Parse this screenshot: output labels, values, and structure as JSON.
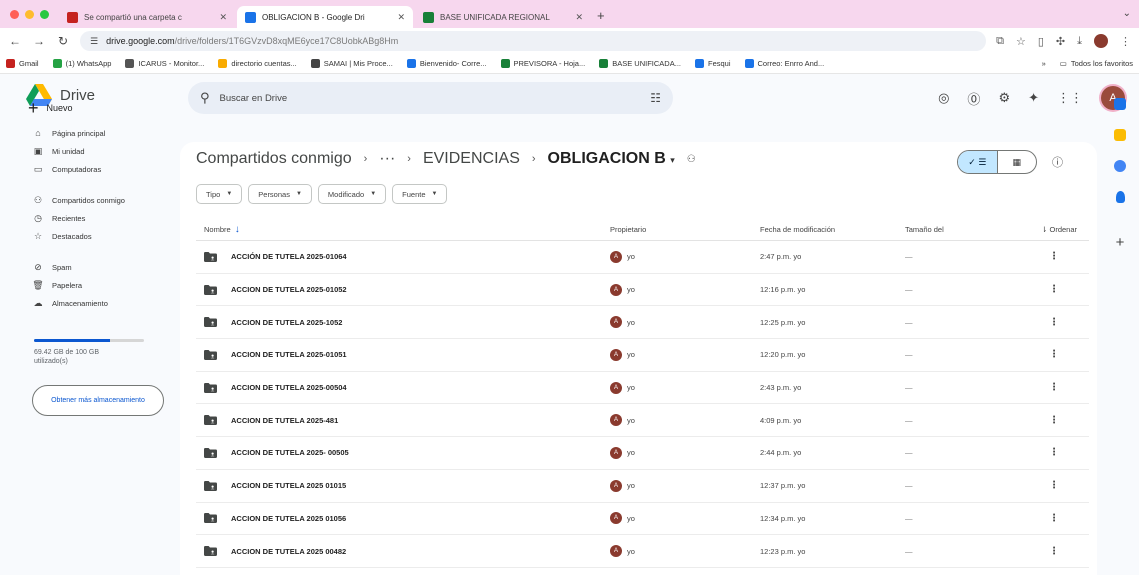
{
  "browser": {
    "tabs": [
      {
        "title": "Se compartió una carpeta c",
        "fav_color": "#c5221f",
        "active": false
      },
      {
        "title": "OBLIGACION B - Google Dri",
        "fav_color": "#1a73e8",
        "active": true
      },
      {
        "title": "BASE UNIFICADA REGIONAL",
        "fav_color": "#188038",
        "active": false
      }
    ],
    "url_host": "drive.google.com",
    "url_path": "/drive/folders/1T6GVzvD8xqME6yce17C8UobkABg8Hm",
    "bookmarks": [
      {
        "label": "Gmail",
        "color": "#c5221f"
      },
      {
        "label": "(1) WhatsApp",
        "color": "#25a244"
      },
      {
        "label": "ICARUS - Monitor...",
        "color": "#555555"
      },
      {
        "label": "directorio cuentas...",
        "color": "#f9ab00"
      },
      {
        "label": "SAMAI | Mis Proce...",
        "color": "#444444"
      },
      {
        "label": "Bienvenido- Corre...",
        "color": "#1a73e8"
      },
      {
        "label": "PREVISORA - Hoja...",
        "color": "#188038"
      },
      {
        "label": "BASE UNIFICADA...",
        "color": "#188038"
      },
      {
        "label": "Fesqui",
        "color": "#1a73e8"
      },
      {
        "label": "Correo: Enrro And...",
        "color": "#1a73e8"
      }
    ],
    "bookmarks_overflow": "»",
    "all_bookmarks": "Todos los favoritos"
  },
  "app": {
    "logo_text": "Drive",
    "search_placeholder": "Buscar en Drive",
    "account_initial": "A",
    "new_label": "Nuevo",
    "nav_items": [
      {
        "label": "Página principal",
        "icon": "home-icon",
        "glyph": "⌂"
      },
      {
        "label": "Mi unidad",
        "icon": "my-drive-icon",
        "glyph": "▣"
      },
      {
        "label": "Computadoras",
        "icon": "computer-icon",
        "glyph": "▭"
      },
      {
        "label": "Compartidos conmigo",
        "icon": "shared-icon",
        "glyph": "⚇"
      },
      {
        "label": "Recientes",
        "icon": "clock-icon",
        "glyph": "◷"
      },
      {
        "label": "Destacados",
        "icon": "star-icon",
        "glyph": "☆"
      },
      {
        "label": "Spam",
        "icon": "spam-icon",
        "glyph": "⊘"
      },
      {
        "label": "Papelera",
        "icon": "trash-icon",
        "glyph": "🗑"
      },
      {
        "label": "Almacenamiento",
        "icon": "cloud-icon",
        "glyph": "☁"
      }
    ],
    "storage_used_fraction": 0.69,
    "storage_text": "69.42 GB de 100 GB utilizado(s)",
    "storage_button": "Obtener más almacenamiento"
  },
  "main": {
    "breadcrumb": {
      "root": "Compartidos conmigo",
      "ellipsis": "···",
      "parent": "EVIDENCIAS",
      "current": "OBLIGACION B"
    },
    "filters": [
      "Tipo",
      "Personas",
      "Modificado",
      "Fuente"
    ],
    "columns": {
      "name": "Nombre",
      "owner": "Propietario",
      "modified": "Fecha de modificación",
      "size": "Tamaño del",
      "sort": "Ordenar"
    },
    "rows": [
      {
        "name": "ACCIÓN DE TUTELA 2025-01064",
        "owner": "yo",
        "modified": "2:47 p.m. yo",
        "size": "—"
      },
      {
        "name": "ACCION DE TUTELA 2025-01052",
        "owner": "yo",
        "modified": "12:16 p.m. yo",
        "size": "—"
      },
      {
        "name": "ACCION DE TUTELA 2025-1052",
        "owner": "yo",
        "modified": "12:25 p.m. yo",
        "size": "—"
      },
      {
        "name": "ACCION DE TUTELA 2025-01051",
        "owner": "yo",
        "modified": "12:20 p.m. yo",
        "size": "—"
      },
      {
        "name": "ACCION DE TUTELA 2025-00504",
        "owner": "yo",
        "modified": "2:43 p.m. yo",
        "size": "—"
      },
      {
        "name": "ACCION DE TUTELA 2025-481",
        "owner": "yo",
        "modified": "4:09 p.m. yo",
        "size": "—"
      },
      {
        "name": "ACCION DE TUTELA 2025- 00505",
        "owner": "yo",
        "modified": "2:44 p.m. yo",
        "size": "—"
      },
      {
        "name": "ACCION DE TUTELA 2025 01015",
        "owner": "yo",
        "modified": "12:37 p.m. yo",
        "size": "—"
      },
      {
        "name": "ACCION DE TUTELA 2025 01056",
        "owner": "yo",
        "modified": "12:34 p.m. yo",
        "size": "—"
      },
      {
        "name": "ACCION DE TUTELA 2025 00482",
        "owner": "yo",
        "modified": "12:23 p.m. yo",
        "size": "—"
      }
    ]
  },
  "colors": {
    "accent": "#0b57d0",
    "selected_toggle": "#c2e7ff",
    "app_bg": "#f8fafd",
    "tabbar": "#f7d7ee"
  }
}
